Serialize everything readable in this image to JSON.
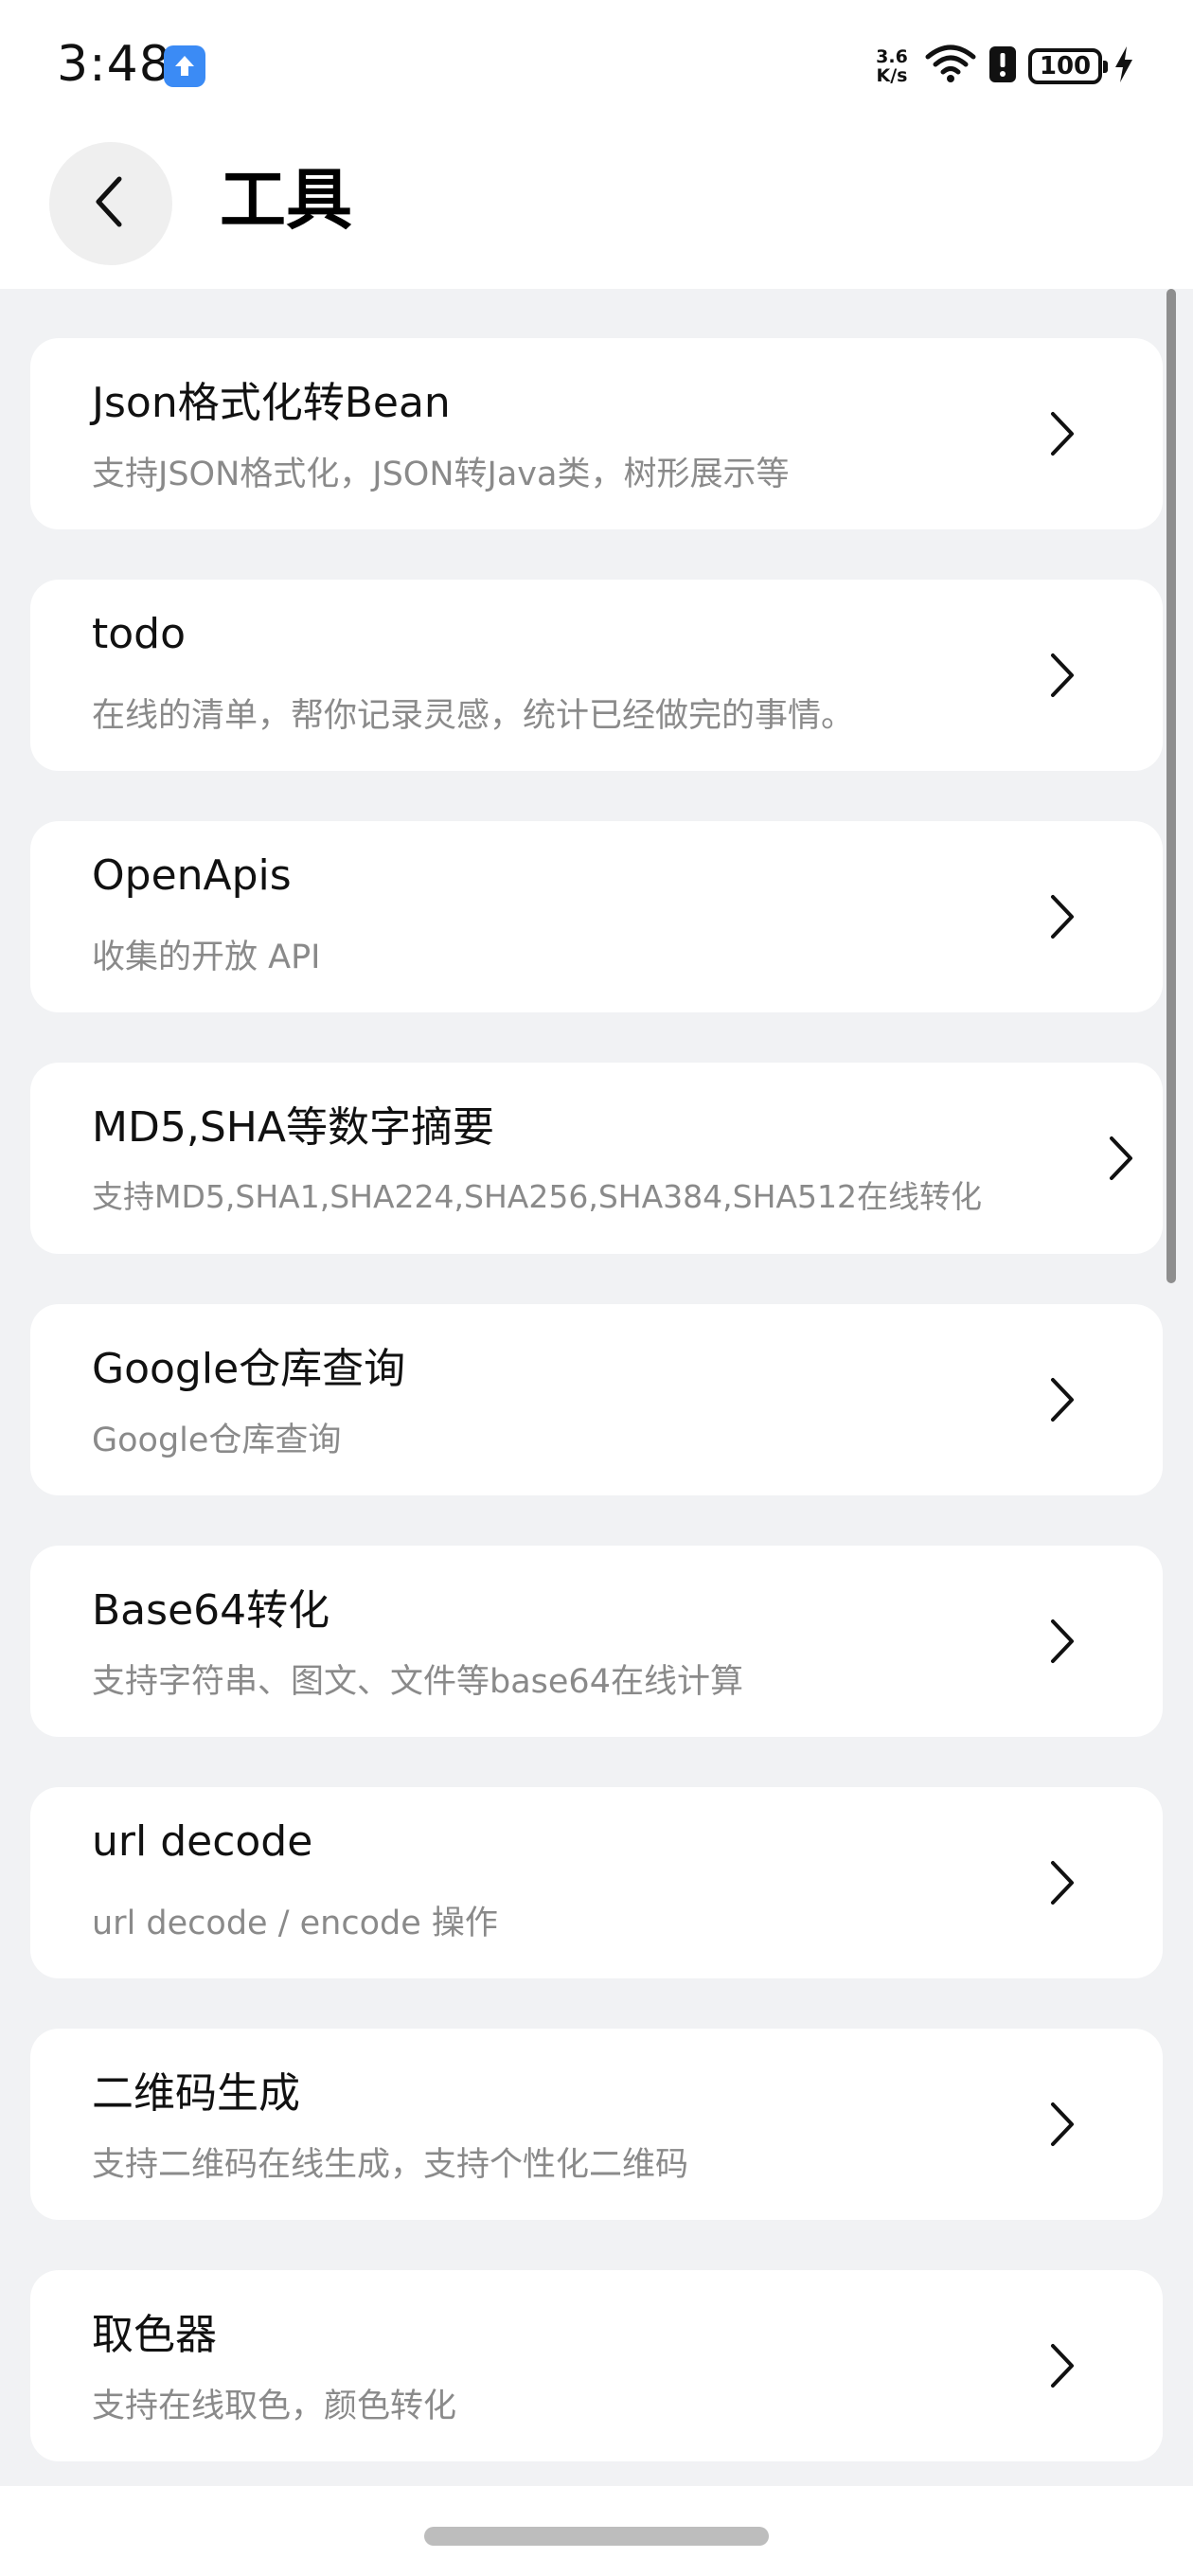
{
  "status_bar": {
    "time": "3:48",
    "net_speed_value": "3.6",
    "net_speed_unit": "K/s",
    "battery_level": "100",
    "icons": [
      "app-update-icon",
      "wifi-icon",
      "alert-icon",
      "battery-icon",
      "charging-icon"
    ]
  },
  "header": {
    "title": "工具",
    "back_icon": "chevron-left-icon"
  },
  "tools": [
    {
      "title": "Json格式化转Bean",
      "desc": "支持JSON格式化，JSON转Java类，树形展示等"
    },
    {
      "title": "todo",
      "desc": "在线的清单，帮你记录灵感，统计已经做完的事情。"
    },
    {
      "title": "OpenApis",
      "desc": "收集的开放 API"
    },
    {
      "title": "MD5,SHA等数字摘要",
      "desc": "支持MD5,SHA1,SHA224,SHA256,SHA384,SHA512在线转化"
    },
    {
      "title": "Google仓库查询",
      "desc": "Google仓库查询"
    },
    {
      "title": "Base64转化",
      "desc": "支持字符串、图文、文件等base64在线计算"
    },
    {
      "title": "url decode",
      "desc": "url decode / encode 操作"
    },
    {
      "title": "二维码生成",
      "desc": "支持二维码在线生成，支持个性化二维码"
    },
    {
      "title": "取色器",
      "desc": "支持在线取色，颜色转化"
    }
  ],
  "colors": {
    "background": "#f1f2f4",
    "card": "#ffffff",
    "title_text": "#111111",
    "desc_text": "#8a8a8a",
    "app_icon_accent": "#3b8bf5"
  }
}
